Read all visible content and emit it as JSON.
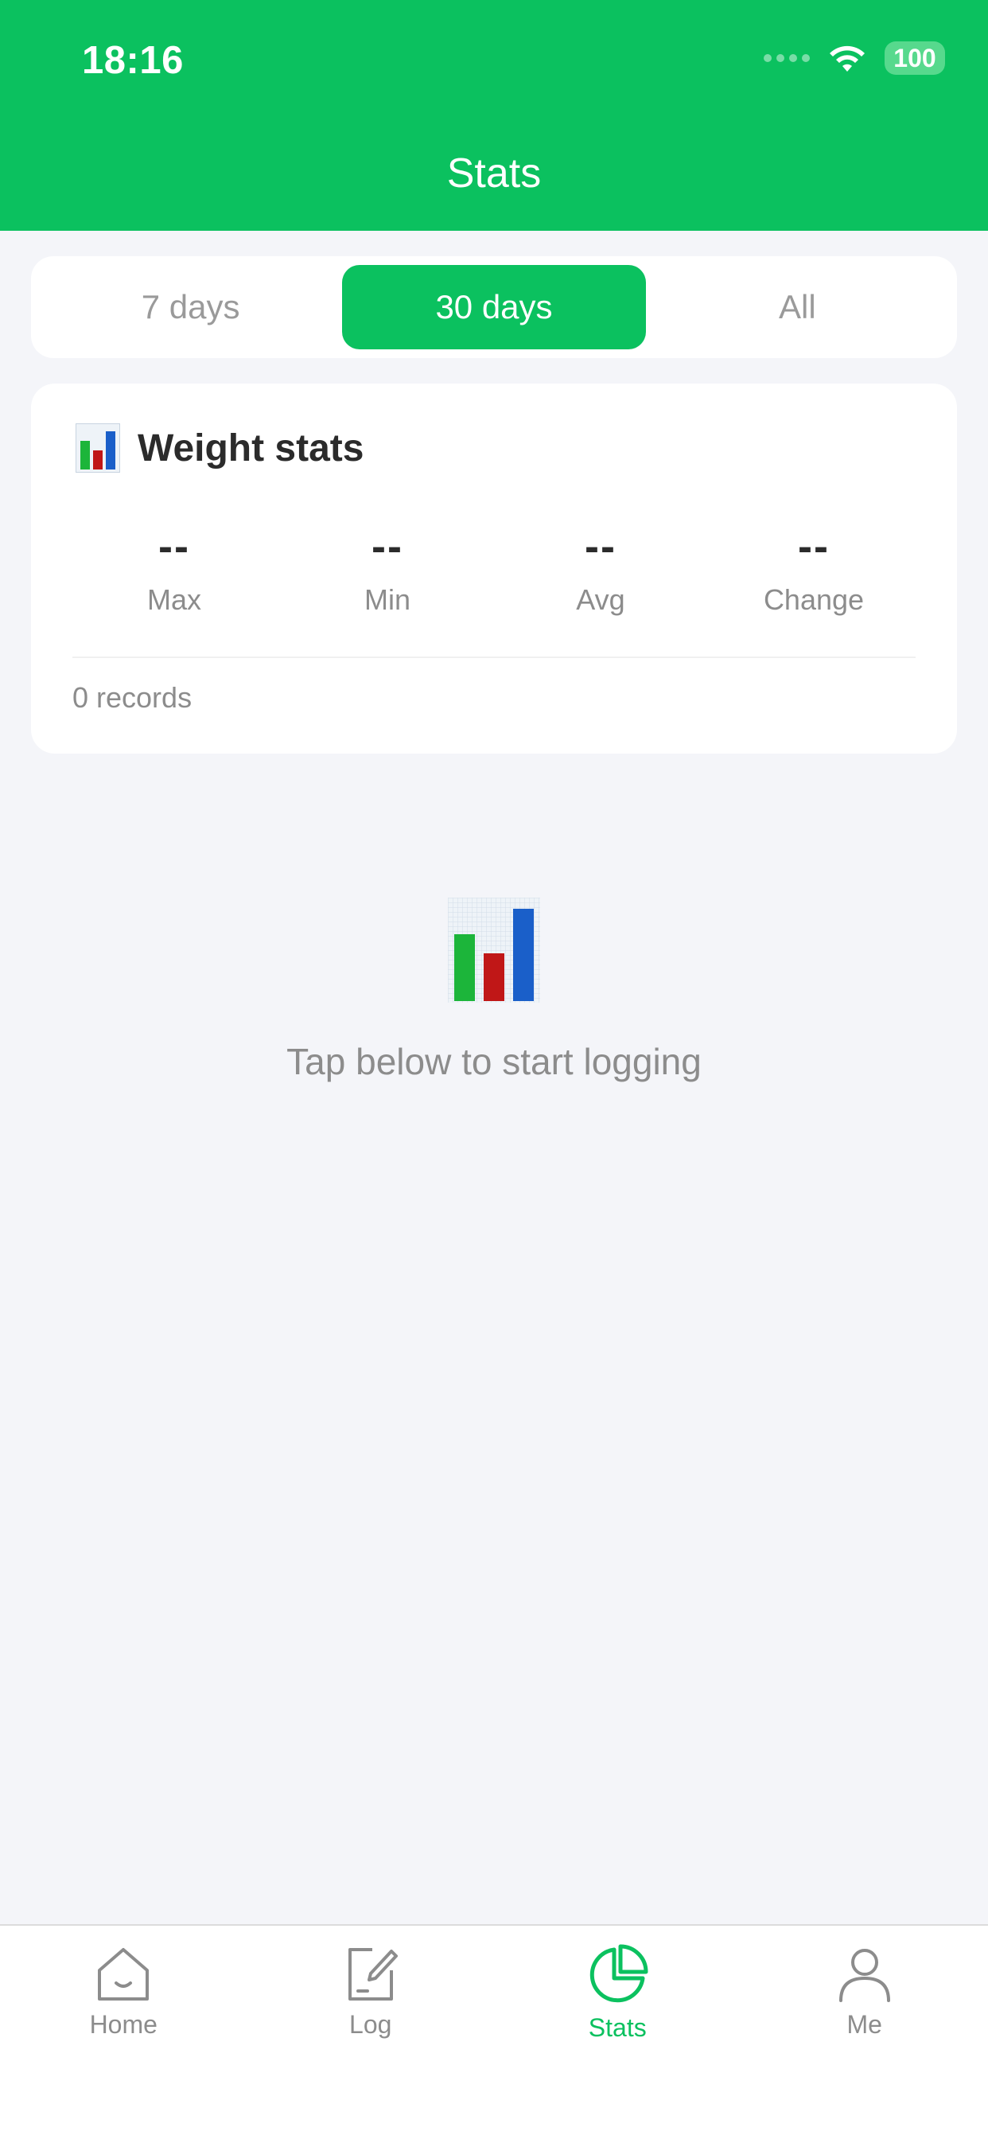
{
  "status_bar": {
    "time": "18:16",
    "battery": "100",
    "icons": [
      "signal-dots-icon",
      "wifi-icon",
      "battery-icon"
    ]
  },
  "header": {
    "title": "Stats"
  },
  "range_tabs": [
    {
      "label": "7 days",
      "active": false
    },
    {
      "label": "30 days",
      "active": true
    },
    {
      "label": "All",
      "active": false
    }
  ],
  "weight_card": {
    "icon": "bar-chart-icon",
    "title": "Weight stats",
    "stats": [
      {
        "value": "--",
        "label": "Max"
      },
      {
        "value": "--",
        "label": "Min"
      },
      {
        "value": "--",
        "label": "Avg"
      },
      {
        "value": "--",
        "label": "Change"
      }
    ],
    "records": "0 records"
  },
  "empty_state": {
    "icon": "bar-chart-icon",
    "text": "Tap below to start logging"
  },
  "tab_bar": [
    {
      "label": "Home",
      "icon": "home-icon",
      "active": false
    },
    {
      "label": "Log",
      "icon": "edit-icon",
      "active": false
    },
    {
      "label": "Stats",
      "icon": "pie-chart-icon",
      "active": true
    },
    {
      "label": "Me",
      "icon": "user-icon",
      "active": false
    }
  ],
  "colors": {
    "primary": "#0bc15f",
    "background": "#f4f5f9",
    "text_dark": "#2b2b2b",
    "text_muted": "#8c8c8c"
  }
}
